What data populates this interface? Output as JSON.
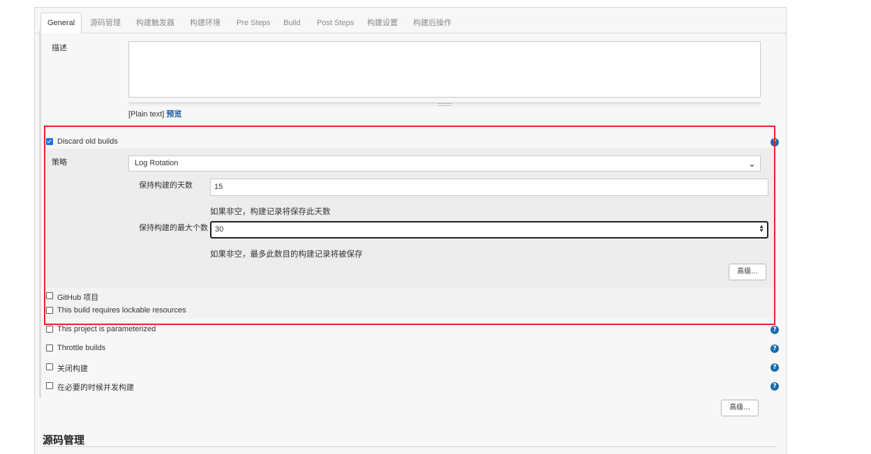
{
  "tabs": [
    "General",
    "源码管理",
    "构建触发器",
    "构建环境",
    "Pre Steps",
    "Build",
    "Post Steps",
    "构建设置",
    "构建后操作"
  ],
  "description": {
    "label": "描述",
    "value": "",
    "format_text": "[Plain text]",
    "preview_link": "预览"
  },
  "discard_old_builds": {
    "label": "Discard old builds",
    "checked": true,
    "strategy_label": "策略",
    "strategy_value": "Log Rotation",
    "days_to_keep": {
      "label": "保持构建的天数",
      "value": "15",
      "help": "如果非空，构建记录将保存此天数"
    },
    "max_builds": {
      "label": "保持构建的最大个数",
      "value": "30",
      "help": "如果非空，最多此数目的构建记录将被保存"
    },
    "advanced_button": "高级..."
  },
  "options": [
    {
      "label": "GitHub 项目",
      "checked": false
    },
    {
      "label": "This build requires lockable resources",
      "checked": false
    },
    {
      "label": "This project is parameterized",
      "checked": false
    },
    {
      "label": "Throttle builds",
      "checked": false
    },
    {
      "label": "关闭构建",
      "checked": false
    },
    {
      "label": "在必要的时候并发构建",
      "checked": false
    }
  ],
  "advanced_button_general": "高级...",
  "next_section_title": "源码管理",
  "help_icon_glyph": "?",
  "colors": {
    "accent_blue": "#1a6aa8",
    "highlight_red": "#e8232a",
    "checkbox_blue": "#1a73e8"
  }
}
